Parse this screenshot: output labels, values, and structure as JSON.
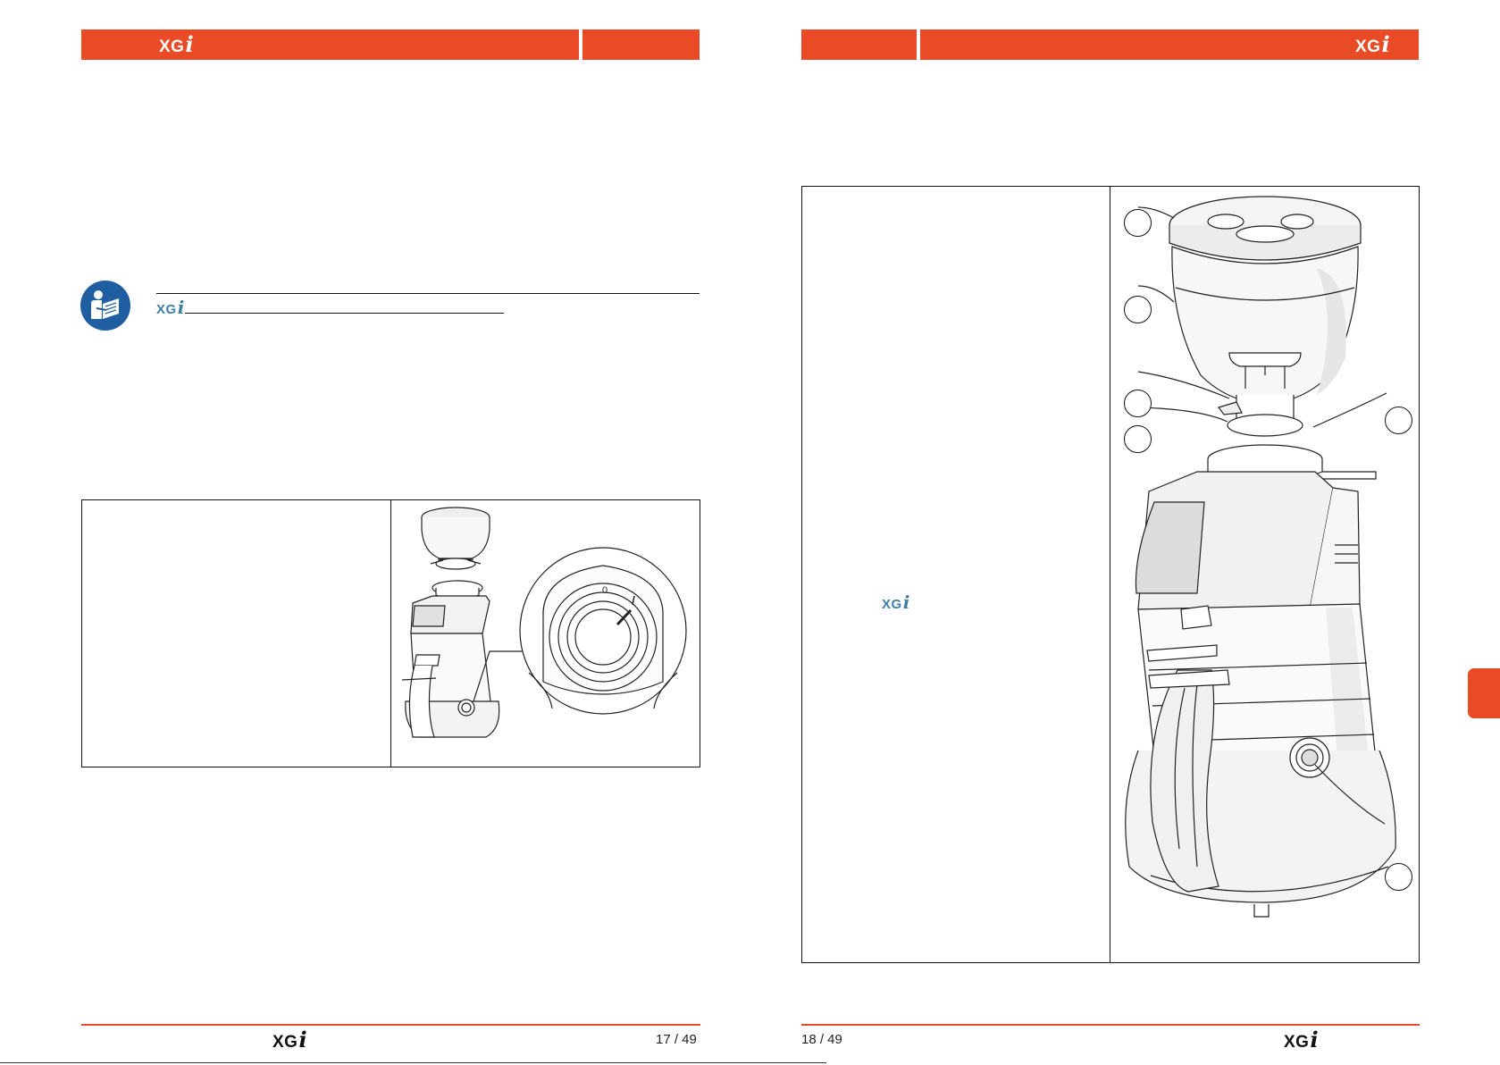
{
  "brand": {
    "name": "XG",
    "suffix": "i"
  },
  "colors": {
    "accent": "#e94b26",
    "brand_blue": "#3f7fa6",
    "icon_blue": "#1f5ea0"
  },
  "icons": {
    "manual": "read-manual-icon"
  },
  "footer": {
    "left_page": "17 / 49",
    "right_page": "18 / 49"
  }
}
